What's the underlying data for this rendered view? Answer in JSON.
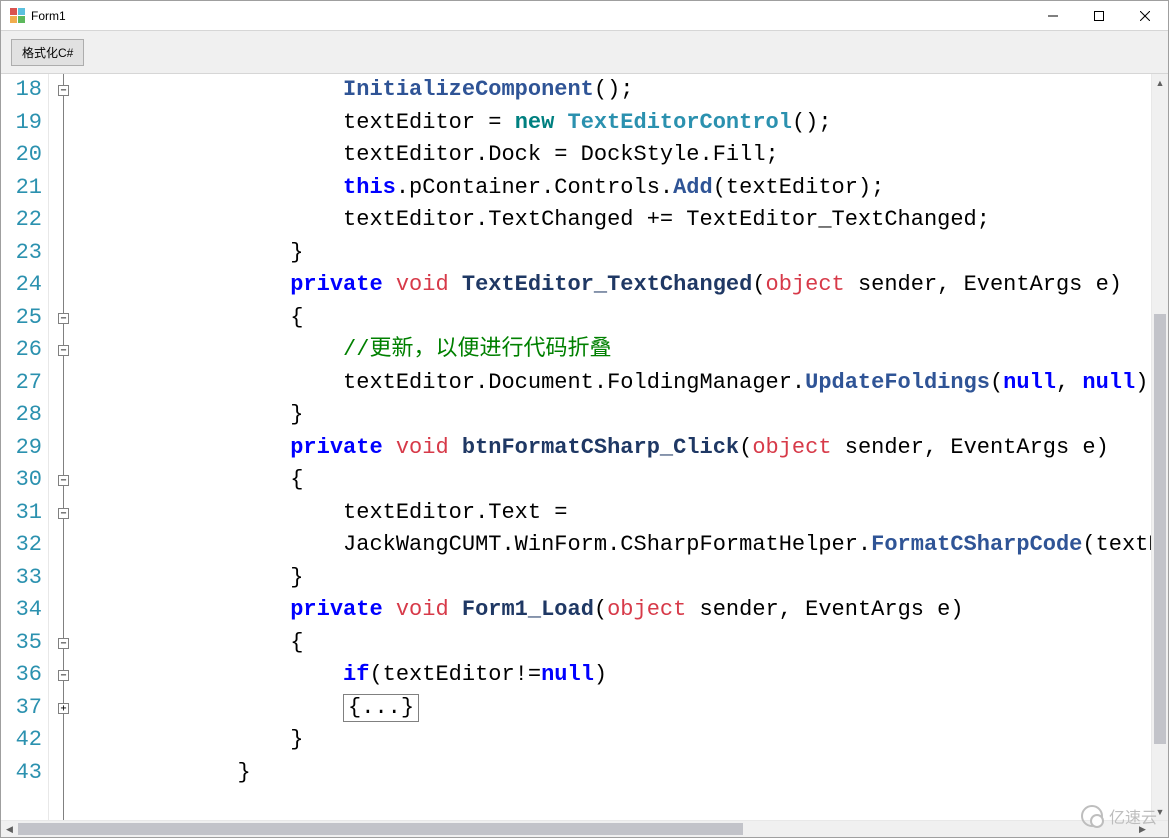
{
  "window": {
    "title": "Form1"
  },
  "toolbar": {
    "format_button": "格式化C#"
  },
  "editor": {
    "line_numbers": [
      "18",
      "19",
      "20",
      "21",
      "22",
      "23",
      "24",
      "25",
      "26",
      "27",
      "28",
      "29",
      "30",
      "31",
      "32",
      "33",
      "34",
      "35",
      "36",
      "37",
      "42",
      "43"
    ],
    "fold_markers": [
      {
        "row": 0,
        "kind": "minus"
      },
      {
        "row": 7,
        "kind": "minus"
      },
      {
        "row": 8,
        "kind": "minus"
      },
      {
        "row": 12,
        "kind": "minus"
      },
      {
        "row": 13,
        "kind": "minus"
      },
      {
        "row": 17,
        "kind": "minus"
      },
      {
        "row": 18,
        "kind": "minus"
      },
      {
        "row": 19,
        "kind": "plus"
      }
    ],
    "code": {
      "l18": {
        "method": "InitializeComponent",
        "tail": "();"
      },
      "l19": {
        "a": "textEditor = ",
        "kw": "new",
        "sp": " ",
        "type": "TextEditorControl",
        "tail": "();"
      },
      "l20": "textEditor.Dock = DockStyle.Fill;",
      "l21": {
        "kw": "this",
        "a": ".pContainer.Controls.",
        "m": "Add",
        "tail": "(textEditor);"
      },
      "l22": "textEditor.TextChanged += TextEditor_TextChanged;",
      "l23": "}",
      "l24": {
        "mods": "private",
        "ret": "void",
        "name": "TextEditor_TextChanged",
        "open": "(",
        "obj": "object",
        "rest": " sender, EventArgs e)"
      },
      "l25": "{",
      "l26": "//更新，以便进行代码折叠",
      "l27": {
        "a": "textEditor.Document.FoldingManager.",
        "m": "UpdateFoldings",
        "open": "(",
        "n1": "null",
        "c": ", ",
        "n2": "null",
        "tail": ");"
      },
      "l28": "}",
      "l29": {
        "mods": "private",
        "ret": "void",
        "name": "btnFormatCSharp_Click",
        "open": "(",
        "obj": "object",
        "rest": " sender, EventArgs e)"
      },
      "l30": "{",
      "l31": "textEditor.Text =",
      "l32": {
        "a": "JackWangCUMT.WinForm.CSharpFormatHelper.",
        "m": "FormatCSharpCode",
        "tail": "(textEd"
      },
      "l33": "}",
      "l34": {
        "mods": "private",
        "ret": "void",
        "name": "Form1_Load",
        "open": "(",
        "obj": "object",
        "rest": " sender, EventArgs e)"
      },
      "l35": "{",
      "l36": {
        "kw": "if",
        "open": "(textEditor!=",
        "n": "null",
        "close": ")"
      },
      "l37": "{...}",
      "l42": "}",
      "l43": "}"
    }
  },
  "watermark": {
    "text": "亿速云"
  }
}
